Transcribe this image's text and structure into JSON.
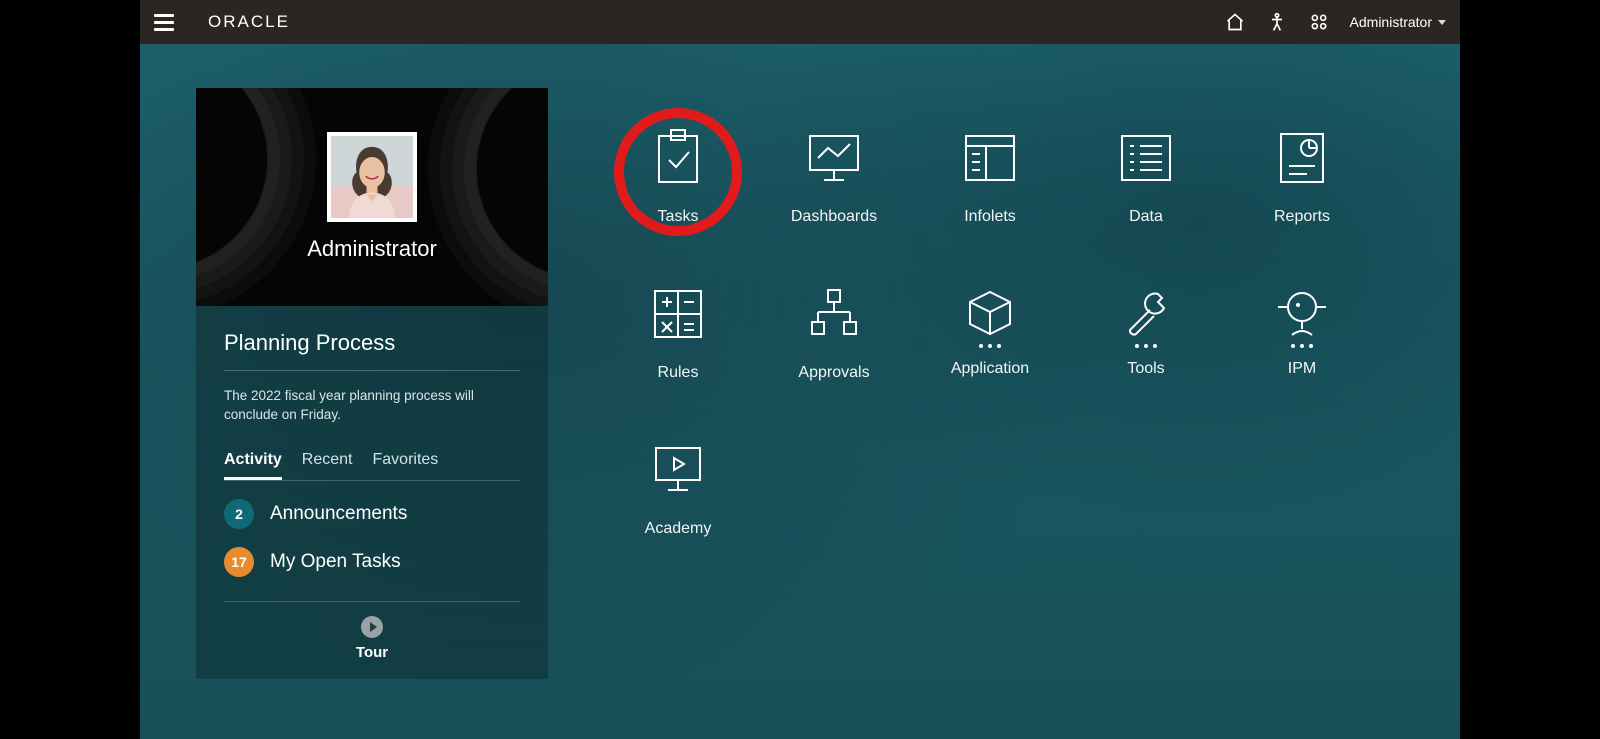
{
  "header": {
    "logo": "ORACLE",
    "user_label": "Administrator"
  },
  "panel": {
    "user_name": "Administrator",
    "process_title": "Planning Process",
    "process_desc": "The 2022 fiscal year planning process will conclude on Friday.",
    "tabs": {
      "activity": "Activity",
      "recent": "Recent",
      "favorites": "Favorites"
    },
    "counts": {
      "announcements": {
        "n": "2",
        "label": "Announcements"
      },
      "open_tasks": {
        "n": "17",
        "label": "My Open Tasks"
      }
    },
    "tour_label": "Tour"
  },
  "tiles": {
    "tasks": "Tasks",
    "dashboards": "Dashboards",
    "infolets": "Infolets",
    "data": "Data",
    "reports": "Reports",
    "rules": "Rules",
    "approvals": "Approvals",
    "application": "Application",
    "tools": "Tools",
    "ipm": "IPM",
    "academy": "Academy"
  }
}
